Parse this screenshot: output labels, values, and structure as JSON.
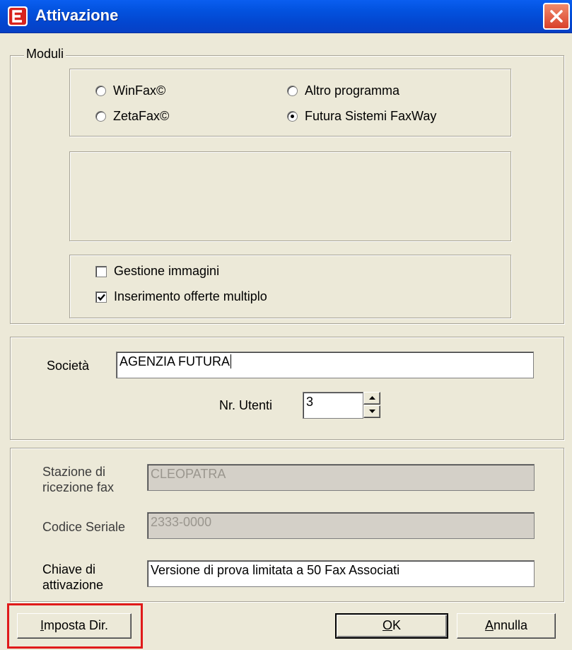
{
  "window": {
    "title": "Attivazione",
    "colors": {
      "titlebar": "#0553e0",
      "close": "#d9412a",
      "face": "#ece9d8",
      "highlight": "#e01a1a"
    }
  },
  "moduli": {
    "legend": "Moduli",
    "radios": [
      {
        "label": "WinFax©",
        "checked": false
      },
      {
        "label": "ZetaFax©",
        "checked": false
      },
      {
        "label": "Altro programma",
        "checked": false
      },
      {
        "label": "Futura Sistemi FaxWay",
        "checked": true
      }
    ],
    "checkboxes": [
      {
        "label": "Gestione immagini",
        "checked": false
      },
      {
        "label": "Inserimento offerte multiplo",
        "checked": true
      }
    ]
  },
  "societa": {
    "label": "Società",
    "value": "AGENZIA FUTURA",
    "utenti_label": "Nr. Utenti",
    "utenti_value": "3"
  },
  "licenza": {
    "stazione_label_1": "Stazione di",
    "stazione_label_2": "ricezione fax",
    "stazione_value": "CLEOPATRA",
    "seriale_label": "Codice Seriale",
    "seriale_value": "2333-0000",
    "chiave_label_1": "Chiave di",
    "chiave_label_2": "attivazione",
    "chiave_value": "Versione di prova limitata a 50 Fax Associati"
  },
  "buttons": {
    "imposta_dir": {
      "mnemonic": "I",
      "rest": "mposta Dir."
    },
    "ok": {
      "mnemonic": "O",
      "rest": "K"
    },
    "annulla": {
      "mnemonic": "A",
      "rest": "nnulla"
    }
  },
  "icons": [
    "app-icon",
    "close-icon",
    "spin-up-icon",
    "spin-down-icon",
    "checkmark-icon"
  ]
}
